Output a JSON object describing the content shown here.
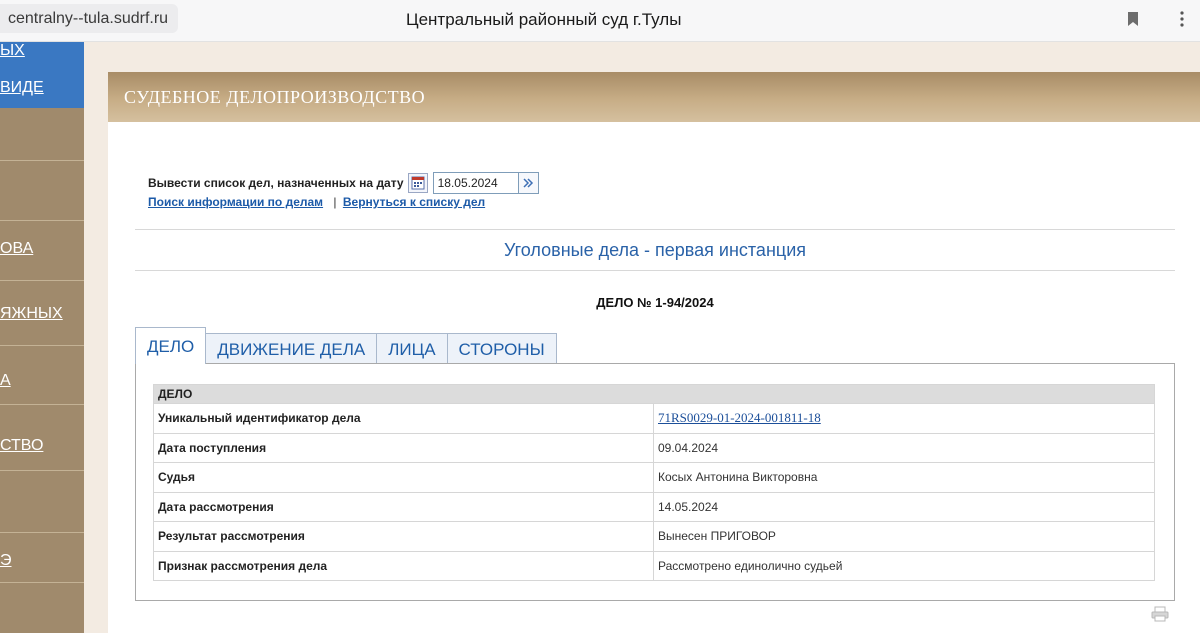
{
  "browser": {
    "url": "centralny--tula.sudrf.ru",
    "title": "Центральный районный суд г.Тулы"
  },
  "sidebar": {
    "items": [
      {
        "label": "ЫХ"
      },
      {
        "label": "ВИДЕ"
      },
      {
        "label": "ОВА"
      },
      {
        "label": "ЯЖНЫХ"
      },
      {
        "label": "А"
      },
      {
        "label": "СТВО"
      },
      {
        "label": "Э"
      }
    ]
  },
  "header": {
    "title": "СУДЕБНОЕ ДЕЛОПРОИЗВОДСТВО"
  },
  "date_filter": {
    "label": "Вывести список дел, назначенных на дату",
    "value": "18.05.2024"
  },
  "links": {
    "search": "Поиск информации по делам",
    "separator": "|",
    "back": "Вернуться к списку дел"
  },
  "section_title": "Уголовные дела - первая инстанция",
  "case_number": "ДЕЛО № 1-94/2024",
  "tabs": [
    {
      "label": "ДЕЛО",
      "active": true
    },
    {
      "label": "ДВИЖЕНИЕ ДЕЛА",
      "active": false
    },
    {
      "label": "ЛИЦА",
      "active": false
    },
    {
      "label": "СТОРОНЫ",
      "active": false
    }
  ],
  "case_table": {
    "header": "ДЕЛО",
    "rows": [
      {
        "key": "Уникальный идентификатор дела",
        "value": "71RS0029-01-2024-001811-18"
      },
      {
        "key": "Дата поступления",
        "value": "09.04.2024"
      },
      {
        "key": "Судья",
        "value": "Косых Антонина Викторовна"
      },
      {
        "key": "Дата рассмотрения",
        "value": "14.05.2024"
      },
      {
        "key": "Результат рассмотрения",
        "value": "Вынесен ПРИГОВОР"
      },
      {
        "key": "Признак рассмотрения дела",
        "value": "Рассмотрено единолично судьей"
      }
    ]
  },
  "colors": {
    "sidebar_brown": "#a08a6c",
    "sidebar_blue": "#3a78c2",
    "link_blue": "#1c5aa8",
    "header_band": "#b89b74"
  }
}
